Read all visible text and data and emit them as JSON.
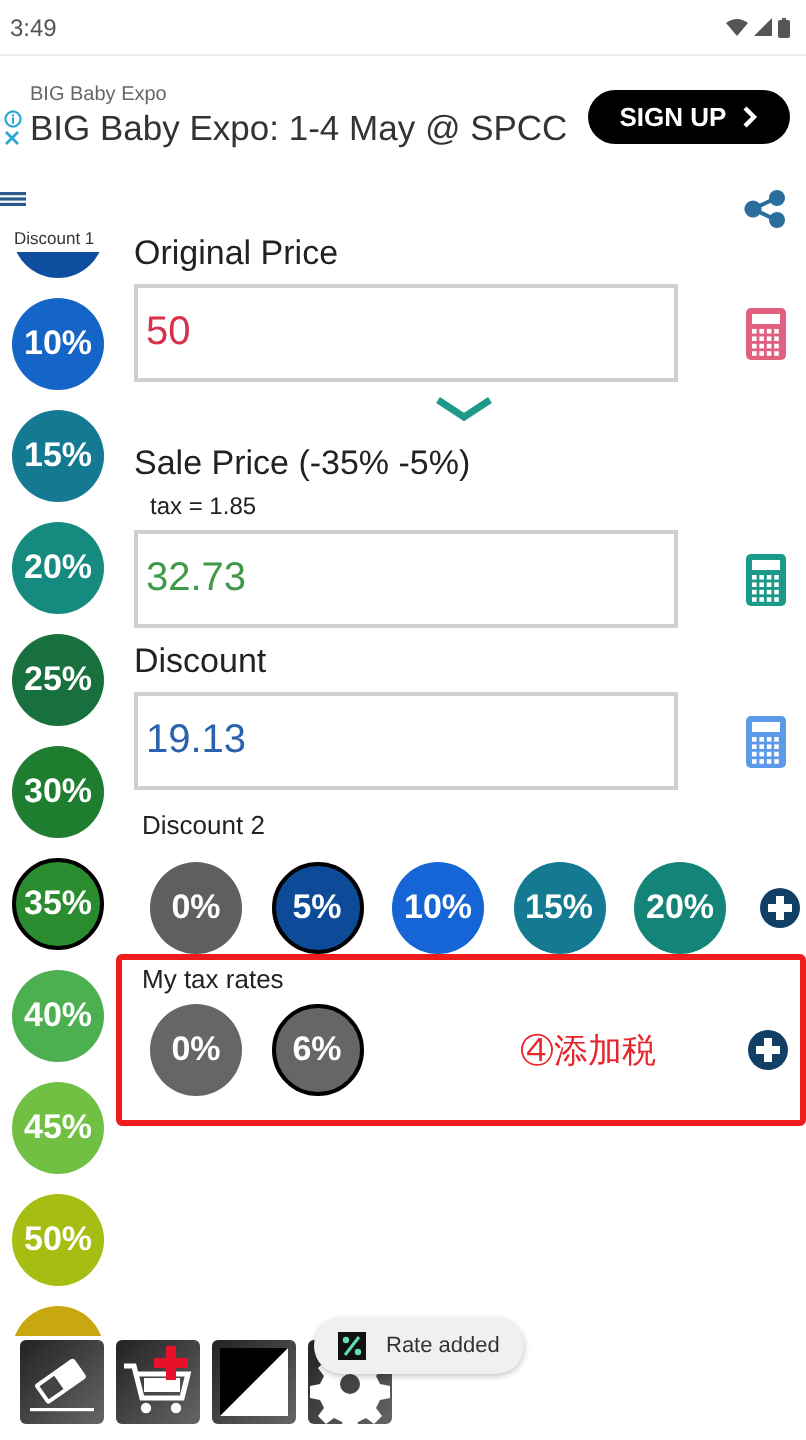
{
  "status_bar": {
    "time": "3:49"
  },
  "ad": {
    "advertiser": "BIG Baby Expo",
    "headline": "BIG Baby Expo: 1-4 May @ SPCC",
    "button": "SIGN UP"
  },
  "discount1": {
    "label": "Discount 1",
    "rates": [
      {
        "kind": "partial",
        "color": "#0d4f9e",
        "selected": false
      },
      {
        "kind": "rate",
        "label": "10%",
        "color": "#1565c9",
        "selected": false
      },
      {
        "kind": "rate",
        "label": "15%",
        "color": "#137a92",
        "selected": false
      },
      {
        "kind": "rate",
        "label": "20%",
        "color": "#158a7e",
        "selected": false
      },
      {
        "kind": "rate",
        "label": "25%",
        "color": "#18703f",
        "selected": false
      },
      {
        "kind": "rate",
        "label": "30%",
        "color": "#1e7d2e",
        "selected": false
      },
      {
        "kind": "rate",
        "label": "35%",
        "color": "#2b8c2f",
        "selected": true
      },
      {
        "kind": "rate",
        "label": "40%",
        "color": "#4caf50",
        "selected": false
      },
      {
        "kind": "rate",
        "label": "45%",
        "color": "#72c043",
        "selected": false
      },
      {
        "kind": "rate",
        "label": "50%",
        "color": "#a6bd12",
        "selected": false
      },
      {
        "kind": "partial",
        "color": "#c8a80f",
        "selected": false
      }
    ]
  },
  "fields": [
    {
      "label": "Original Price",
      "value": "50",
      "color": "#d8324a",
      "calculator": {
        "color": "#e06080"
      }
    },
    {
      "label": "Sale Price (-35% -5%)",
      "note": "tax = 1.85",
      "value": "32.73",
      "color": "#3e9a48",
      "calculator": {
        "color": "#1b9a8a"
      }
    },
    {
      "label": "Discount",
      "value": "19.13",
      "color": "#2a62ae",
      "calculator": {
        "color": "#5b9ae8"
      }
    }
  ],
  "discount2": {
    "label": "Discount 2",
    "rates": [
      {
        "label": "0%",
        "color": "#5f5f62",
        "selected": false
      },
      {
        "label": "5%",
        "color": "#0d4b98",
        "selected": true
      },
      {
        "label": "10%",
        "color": "#1565d6",
        "selected": false
      },
      {
        "label": "15%",
        "color": "#137a92",
        "selected": false
      },
      {
        "label": "20%",
        "color": "#138477",
        "selected": false
      }
    ]
  },
  "tax_rates": {
    "label": "My tax rates",
    "rates": [
      {
        "label": "0%",
        "color": "#666666",
        "selected": false
      },
      {
        "label": "6%",
        "color": "#666666",
        "selected": true
      }
    ]
  },
  "annotation": {
    "text": "④添加税"
  },
  "toolbar": [
    {
      "kind": "eraser"
    },
    {
      "kind": "cart"
    },
    {
      "kind": "contrast"
    },
    {
      "kind": "settings"
    }
  ],
  "toast": {
    "text": "Rate added"
  }
}
